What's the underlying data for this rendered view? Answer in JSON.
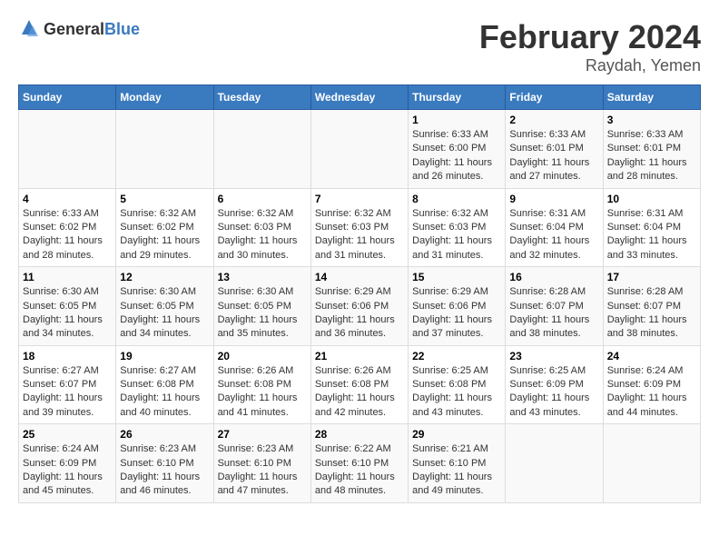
{
  "header": {
    "logo": {
      "general": "General",
      "blue": "Blue"
    },
    "title": "February 2024",
    "subtitle": "Raydah, Yemen"
  },
  "calendar": {
    "weekdays": [
      "Sunday",
      "Monday",
      "Tuesday",
      "Wednesday",
      "Thursday",
      "Friday",
      "Saturday"
    ],
    "weeks": [
      [
        {
          "day": "",
          "info": ""
        },
        {
          "day": "",
          "info": ""
        },
        {
          "day": "",
          "info": ""
        },
        {
          "day": "",
          "info": ""
        },
        {
          "day": "1",
          "info": "Sunrise: 6:33 AM\nSunset: 6:00 PM\nDaylight: 11 hours and 26 minutes."
        },
        {
          "day": "2",
          "info": "Sunrise: 6:33 AM\nSunset: 6:01 PM\nDaylight: 11 hours and 27 minutes."
        },
        {
          "day": "3",
          "info": "Sunrise: 6:33 AM\nSunset: 6:01 PM\nDaylight: 11 hours and 28 minutes."
        }
      ],
      [
        {
          "day": "4",
          "info": "Sunrise: 6:33 AM\nSunset: 6:02 PM\nDaylight: 11 hours and 28 minutes."
        },
        {
          "day": "5",
          "info": "Sunrise: 6:32 AM\nSunset: 6:02 PM\nDaylight: 11 hours and 29 minutes."
        },
        {
          "day": "6",
          "info": "Sunrise: 6:32 AM\nSunset: 6:03 PM\nDaylight: 11 hours and 30 minutes."
        },
        {
          "day": "7",
          "info": "Sunrise: 6:32 AM\nSunset: 6:03 PM\nDaylight: 11 hours and 31 minutes."
        },
        {
          "day": "8",
          "info": "Sunrise: 6:32 AM\nSunset: 6:03 PM\nDaylight: 11 hours and 31 minutes."
        },
        {
          "day": "9",
          "info": "Sunrise: 6:31 AM\nSunset: 6:04 PM\nDaylight: 11 hours and 32 minutes."
        },
        {
          "day": "10",
          "info": "Sunrise: 6:31 AM\nSunset: 6:04 PM\nDaylight: 11 hours and 33 minutes."
        }
      ],
      [
        {
          "day": "11",
          "info": "Sunrise: 6:30 AM\nSunset: 6:05 PM\nDaylight: 11 hours and 34 minutes."
        },
        {
          "day": "12",
          "info": "Sunrise: 6:30 AM\nSunset: 6:05 PM\nDaylight: 11 hours and 34 minutes."
        },
        {
          "day": "13",
          "info": "Sunrise: 6:30 AM\nSunset: 6:05 PM\nDaylight: 11 hours and 35 minutes."
        },
        {
          "day": "14",
          "info": "Sunrise: 6:29 AM\nSunset: 6:06 PM\nDaylight: 11 hours and 36 minutes."
        },
        {
          "day": "15",
          "info": "Sunrise: 6:29 AM\nSunset: 6:06 PM\nDaylight: 11 hours and 37 minutes."
        },
        {
          "day": "16",
          "info": "Sunrise: 6:28 AM\nSunset: 6:07 PM\nDaylight: 11 hours and 38 minutes."
        },
        {
          "day": "17",
          "info": "Sunrise: 6:28 AM\nSunset: 6:07 PM\nDaylight: 11 hours and 38 minutes."
        }
      ],
      [
        {
          "day": "18",
          "info": "Sunrise: 6:27 AM\nSunset: 6:07 PM\nDaylight: 11 hours and 39 minutes."
        },
        {
          "day": "19",
          "info": "Sunrise: 6:27 AM\nSunset: 6:08 PM\nDaylight: 11 hours and 40 minutes."
        },
        {
          "day": "20",
          "info": "Sunrise: 6:26 AM\nSunset: 6:08 PM\nDaylight: 11 hours and 41 minutes."
        },
        {
          "day": "21",
          "info": "Sunrise: 6:26 AM\nSunset: 6:08 PM\nDaylight: 11 hours and 42 minutes."
        },
        {
          "day": "22",
          "info": "Sunrise: 6:25 AM\nSunset: 6:08 PM\nDaylight: 11 hours and 43 minutes."
        },
        {
          "day": "23",
          "info": "Sunrise: 6:25 AM\nSunset: 6:09 PM\nDaylight: 11 hours and 43 minutes."
        },
        {
          "day": "24",
          "info": "Sunrise: 6:24 AM\nSunset: 6:09 PM\nDaylight: 11 hours and 44 minutes."
        }
      ],
      [
        {
          "day": "25",
          "info": "Sunrise: 6:24 AM\nSunset: 6:09 PM\nDaylight: 11 hours and 45 minutes."
        },
        {
          "day": "26",
          "info": "Sunrise: 6:23 AM\nSunset: 6:10 PM\nDaylight: 11 hours and 46 minutes."
        },
        {
          "day": "27",
          "info": "Sunrise: 6:23 AM\nSunset: 6:10 PM\nDaylight: 11 hours and 47 minutes."
        },
        {
          "day": "28",
          "info": "Sunrise: 6:22 AM\nSunset: 6:10 PM\nDaylight: 11 hours and 48 minutes."
        },
        {
          "day": "29",
          "info": "Sunrise: 6:21 AM\nSunset: 6:10 PM\nDaylight: 11 hours and 49 minutes."
        },
        {
          "day": "",
          "info": ""
        },
        {
          "day": "",
          "info": ""
        }
      ]
    ]
  }
}
